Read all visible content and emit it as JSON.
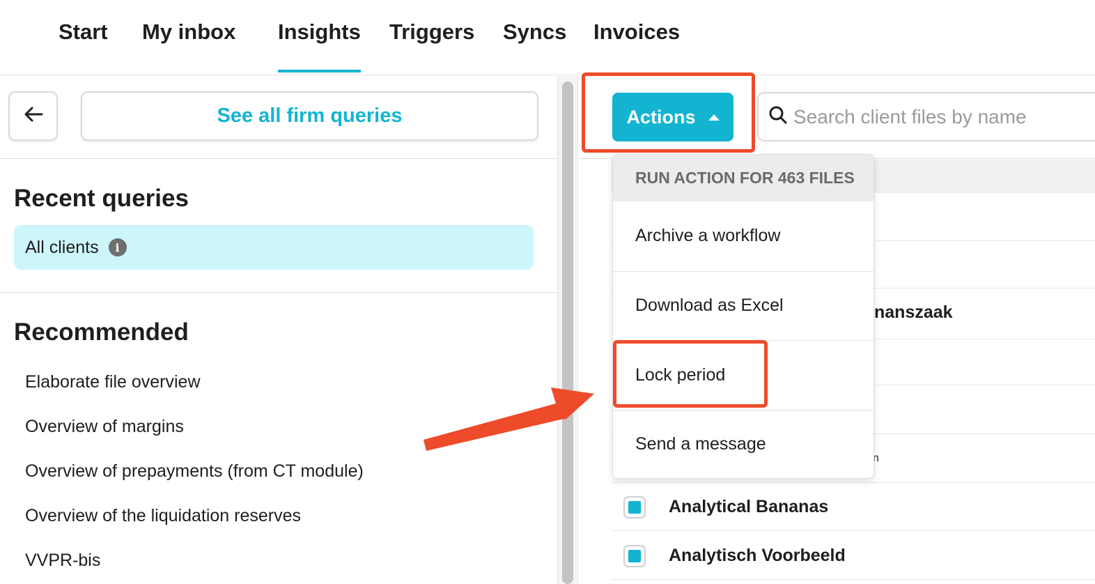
{
  "nav": {
    "tabs": [
      {
        "label": "Start"
      },
      {
        "label": "My inbox"
      },
      {
        "label": "Insights"
      },
      {
        "label": "Triggers"
      },
      {
        "label": "Syncs"
      },
      {
        "label": "Invoices"
      }
    ],
    "active_tab": "Insights"
  },
  "left": {
    "back_icon": "arrow-left-icon",
    "firm_queries_label": "See all firm queries",
    "recent_title": "Recent queries",
    "recent_items": [
      {
        "label": "All clients",
        "icon": "info-icon"
      }
    ],
    "recommended_title": "Recommended",
    "recommended_items": [
      "Elaborate file overview",
      "Overview of margins",
      "Overview of prepayments (from CT module)",
      "Overview of the liquidation reserves",
      "VVPR-bis"
    ]
  },
  "toolbar": {
    "actions_label": "Actions",
    "search_placeholder": "Search client files by name"
  },
  "dropdown": {
    "header": "RUN ACTION FOR 463 FILES",
    "items": [
      "Archive a workflow",
      "Download as Excel",
      "Lock period",
      "Send a message"
    ]
  },
  "table": {
    "partial_texts": [
      "nanszaak",
      "n"
    ],
    "rows": [
      {
        "name": "Analytical Bananas",
        "checked": true
      },
      {
        "name": "Analytisch Voorbeeld",
        "checked": true
      }
    ]
  },
  "colors": {
    "accent": "#12b4d1",
    "annotation": "#ee4b2b",
    "recent_bg": "#cdf6fb"
  }
}
